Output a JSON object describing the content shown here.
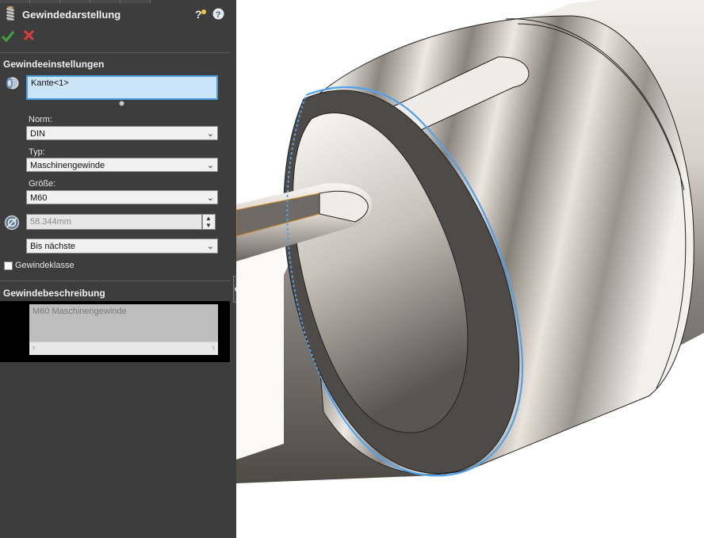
{
  "panel": {
    "title": "Gewindedarstellung",
    "settings_heading": "Gewindeeinstellungen",
    "edge_selection": "Kante<1>",
    "norm_label": "Norm:",
    "norm_value": "DIN",
    "typ_label": "Typ:",
    "typ_value": "Maschinengewinde",
    "groesse_label": "Größe:",
    "groesse_value": "M60",
    "diameter_value": "58.344mm",
    "end_condition": "Bis nächste",
    "thread_class_label": "Gewindeklasse",
    "description_heading": "Gewindebeschreibung",
    "description_value": "M60 Maschinengewinde"
  },
  "colors": {
    "panel_bg": "#3d3d3d",
    "selection_field": "#cce4f7",
    "selection_border": "#4a9fe0",
    "edge_highlight": "#4da3f0",
    "ok_green": "#3ca83c",
    "cancel_red": "#e03b3b"
  },
  "icons": [
    "thread-feature-icon",
    "help-bulb-icon",
    "help-icon",
    "ok-check-icon",
    "cancel-x-icon",
    "edge-selection-icon",
    "diameter-icon"
  ]
}
